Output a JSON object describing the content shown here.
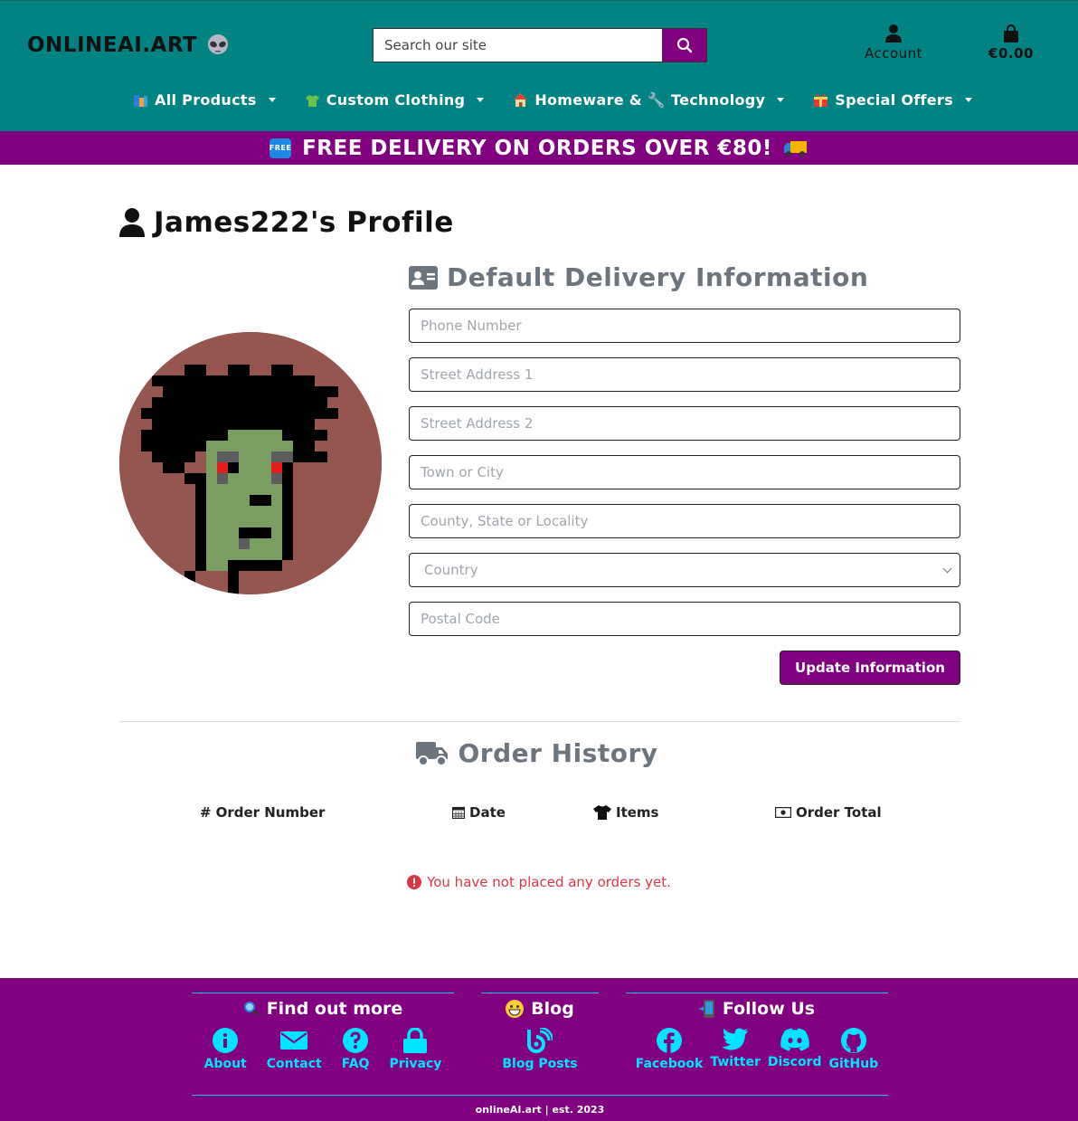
{
  "header": {
    "logo": "ONLINEAI.ART",
    "search_placeholder": "Search our site",
    "account_label": "Account",
    "bag_total": "€0.00"
  },
  "nav": {
    "items": [
      {
        "label": "All Products",
        "icon": "books-icon"
      },
      {
        "label": "Custom Clothing",
        "icon": "tshirt-icon"
      },
      {
        "label": "Homeware & 🔧 Technology",
        "icon": "house-icon"
      },
      {
        "label": "Special Offers",
        "icon": "gift-icon"
      }
    ]
  },
  "banner": {
    "badge": "FREE",
    "text": "FREE DELIVERY ON ORDERS OVER €80!"
  },
  "profile": {
    "title": "James222's Profile"
  },
  "delivery": {
    "title": "Default Delivery Information",
    "fields": {
      "phone": "Phone Number",
      "street1": "Street Address 1",
      "street2": "Street Address 2",
      "town": "Town or City",
      "county": "County, State or Locality",
      "country": "Country",
      "postcode": "Postal Code"
    },
    "button": "Update Information"
  },
  "orders": {
    "title": "Order History",
    "columns": {
      "number": "Order Number",
      "date": "Date",
      "items": "Items",
      "total": "Order Total"
    },
    "empty_message": "You have not placed any orders yet."
  },
  "footer": {
    "find_out_more": {
      "title": "Find out more",
      "links": [
        "About",
        "Contact",
        "FAQ",
        "Privacy"
      ]
    },
    "blog": {
      "title": "Blog",
      "links": [
        "Blog Posts"
      ]
    },
    "follow": {
      "title": "Follow Us",
      "links": [
        "Facebook",
        "Twitter",
        "Discord",
        "GitHub"
      ]
    },
    "copyright": "onlineAI.art | est. 2023"
  },
  "colors": {
    "header_teal": "#028383",
    "brand_purple": "#800080",
    "footer_link_cyan": "#00e5ff",
    "error_red": "#dc3545"
  }
}
